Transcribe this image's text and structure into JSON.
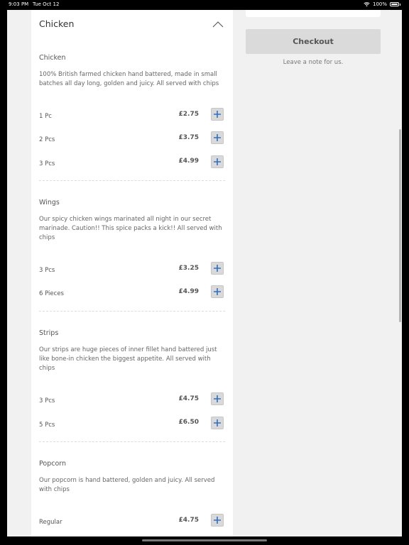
{
  "status_bar": {
    "time": "9:03 PM",
    "date": "Tue Oct 12",
    "battery": "100%"
  },
  "category": {
    "title": "Chicken",
    "icon": "chevron-up-icon"
  },
  "sections": [
    {
      "title": "Chicken",
      "description": "100% British farmed chicken hand battered, made in small batches all day long, golden and juicy. All served with chips",
      "items": [
        {
          "label": "1 Pc",
          "price": "£2.75"
        },
        {
          "label": "2 Pcs",
          "price": "£3.75"
        },
        {
          "label": "3 Pcs",
          "price": "£4.99"
        }
      ]
    },
    {
      "title": "Wings",
      "description": "Our spicy chicken wings marinated all night in our secret marinade. Caution!! This spice packs a kick!! All served with chips",
      "items": [
        {
          "label": "3 Pcs",
          "price": "£3.25"
        },
        {
          "label": "6 Pieces",
          "price": "£4.99"
        }
      ]
    },
    {
      "title": "Strips",
      "description": "Our strips are huge pieces of inner fillet hand battered just like bone-in chicken the biggest appetite. All served with chips",
      "items": [
        {
          "label": "3 Pcs",
          "price": "£4.75"
        },
        {
          "label": "5 Pcs",
          "price": "£6.50"
        }
      ]
    },
    {
      "title": "Popcorn",
      "description": "Our popcorn is hand battered, golden and juicy. All served with chips",
      "items": [
        {
          "label": "Regular",
          "price": "£4.75"
        }
      ]
    }
  ],
  "cart": {
    "checkout_label": "Checkout",
    "note_label": "Leave a note for us."
  },
  "colors": {
    "add_icon": "#2f6fc4",
    "button_bg": "#dadada",
    "screen_bg": "#f1f1f1"
  }
}
